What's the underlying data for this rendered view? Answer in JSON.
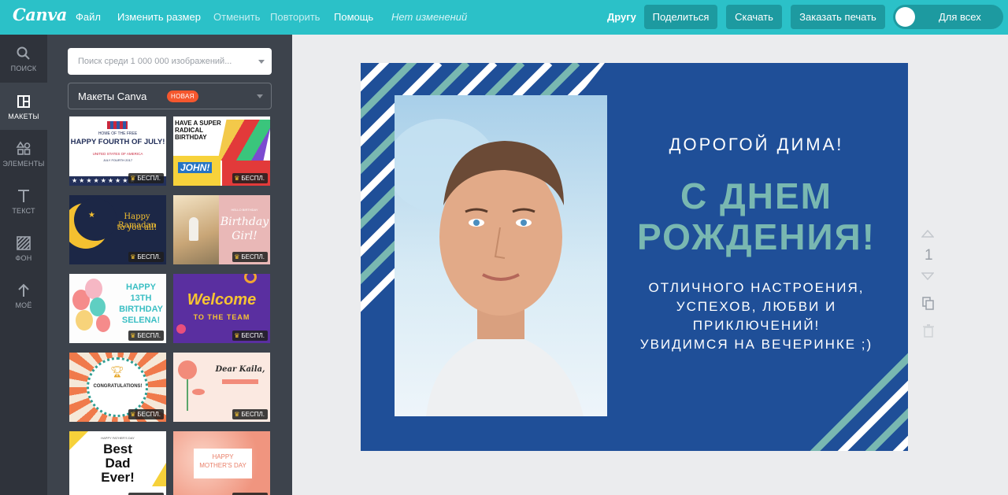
{
  "app": {
    "logo": "Canva",
    "status": "Нет изменений"
  },
  "menu": {
    "file": "Файл",
    "resize": "Изменить размер",
    "undo": "Отменить",
    "redo": "Повторить",
    "help": "Помощь"
  },
  "topbar": {
    "share_with": "Другу",
    "share": "Поделиться",
    "download": "Скачать",
    "print": "Заказать печать",
    "visibility": "Для всех"
  },
  "rail": {
    "items": [
      {
        "label": "ПОИСК",
        "icon": "search-icon"
      },
      {
        "label": "МАКЕТЫ",
        "icon": "layouts-icon"
      },
      {
        "label": "ЭЛЕМЕНТЫ",
        "icon": "elements-icon"
      },
      {
        "label": "ТЕКСТ",
        "icon": "text-icon"
      },
      {
        "label": "ФОН",
        "icon": "background-icon"
      },
      {
        "label": "МОЁ",
        "icon": "upload-icon"
      }
    ],
    "active": "МАКЕТЫ"
  },
  "panel": {
    "search_placeholder": "Поиск среди 1 000 000 изображений...",
    "filter_value": "Макеты Canva",
    "filter_badge": "НОВАЯ",
    "free_label": "БЕСПЛ.",
    "templates": [
      {
        "t1": "HOME OF THE FREE",
        "t2": "HAPPY FOURTH OF JULY!",
        "t3": "UNITED STATES OF AMERICA",
        "t4": "JULY FOURTH 2017"
      },
      {
        "t1": "HAVE A SUPER",
        "t2": "RADICAL",
        "t3": "BIRTHDAY",
        "t4": "JOHN!"
      },
      {
        "t1": "Happy Ramadan",
        "t2": "to you all!"
      },
      {
        "t1": "HELLO BIRTHDAY",
        "t2": "Birthday",
        "t3": "Girl!"
      },
      {
        "t1": "HAPPY",
        "t2": "13TH",
        "t3": "BIRTHDAY",
        "t4": "SELENA!"
      },
      {
        "t1": "Welcome",
        "t2": "TO THE TEAM"
      },
      {
        "t1": "CONGRATULATIONS!"
      },
      {
        "t1": "Dear Kaila,"
      },
      {
        "t1": "HAPPY FATHER'S DAY",
        "t2": "Best",
        "t3": "Dad",
        "t4": "Ever!"
      },
      {
        "t1": "HAPPY",
        "t2": "MOTHER'S DAY"
      }
    ]
  },
  "card": {
    "greeting": "ДОРОГОЙ ДИМА!",
    "headline_1": "С ДНЕМ",
    "headline_2": "РОЖДЕНИЯ!",
    "wish_1": "ОТЛИЧНОГО НАСТРОЕНИЯ,",
    "wish_2": "УСПЕХОВ, ЛЮБВИ И",
    "wish_3": "ПРИКЛЮЧЕНИЙ!",
    "wish_4": "УВИДИМСЯ НА ВЕЧЕРИНКЕ  ;)",
    "colors": {
      "background": "#1f4f98",
      "accent": "#79b8b1",
      "stripes_light": "#ffffff"
    }
  },
  "page": {
    "number": "1"
  }
}
